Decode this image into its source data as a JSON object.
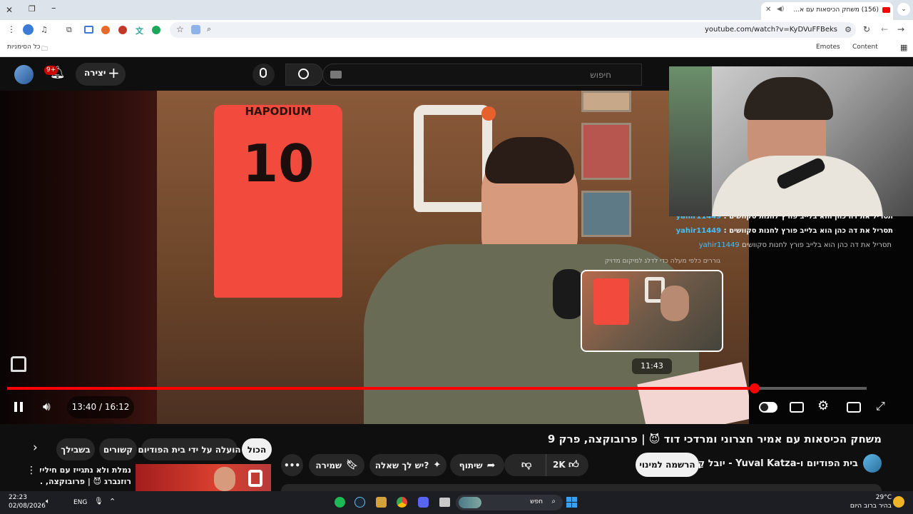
{
  "browser": {
    "tab_title": "(156) משחק הכיסאות עם א...",
    "url": "youtube.com/watch?v=KyDVuFFBeks",
    "bookmarks_all": "כל הסימניות",
    "bookmark_emotes": "Emotes",
    "bookmark_content": "Content"
  },
  "youtube": {
    "search_placeholder": "חיפוש",
    "create_label": "יצירה",
    "notifications_count": "9+"
  },
  "player": {
    "time_display": "13:40 / 16:12",
    "hover_time": "11:43",
    "progress_fraction": 0.87,
    "buffered_fraction": 1.0,
    "jersey_name": "HAPODIUM",
    "jersey_number": "10",
    "chat": [
      {
        "name": "yahir11449",
        "text": "תסריל את דה כהן הוא בלייב פורץ לחנות סקוושים :"
      },
      {
        "name": "yahir11449",
        "text": "תסריל את דה כהן הוא בלייב פורץ לחנות סקוושים :"
      },
      {
        "name": "yahir11449",
        "text": "תסריל את דה כהן הוא בלייב פורץ לחנות סקוושים"
      }
    ],
    "overlay_hint": "גוררים כלפי מעלה כדי לדלג למיקום מדויק"
  },
  "video": {
    "title": "משחק הכיסאות עם אמיר חצרוני ומרדכי דוד 😈 | פרובוקצה, פרק 9",
    "channel": "בית הפודיום ו-Yuval Katza - יובל קַצָה",
    "subscribe_label": "הרשמה למינוי",
    "likes": "2K",
    "share_label": "שיתוף",
    "ask_label": "יש לך שאלה?",
    "save_label": "שמירה"
  },
  "chips": [
    "הכול",
    "הועלה על ידי בית הפודיום",
    "קשורים",
    "בשבילך"
  ],
  "recommendation": {
    "title_line1": "נמלת ולא נתגייז עם חיליק",
    "title_line2": "רוזנברג 😈 | פרובוקצה, ..."
  },
  "taskbar": {
    "time": "22:23",
    "date": "02/08/2026",
    "lang": "ENG",
    "search_label": "חפש",
    "weather_temp": "29°C",
    "weather_desc": "בהיר ברוב היום"
  }
}
